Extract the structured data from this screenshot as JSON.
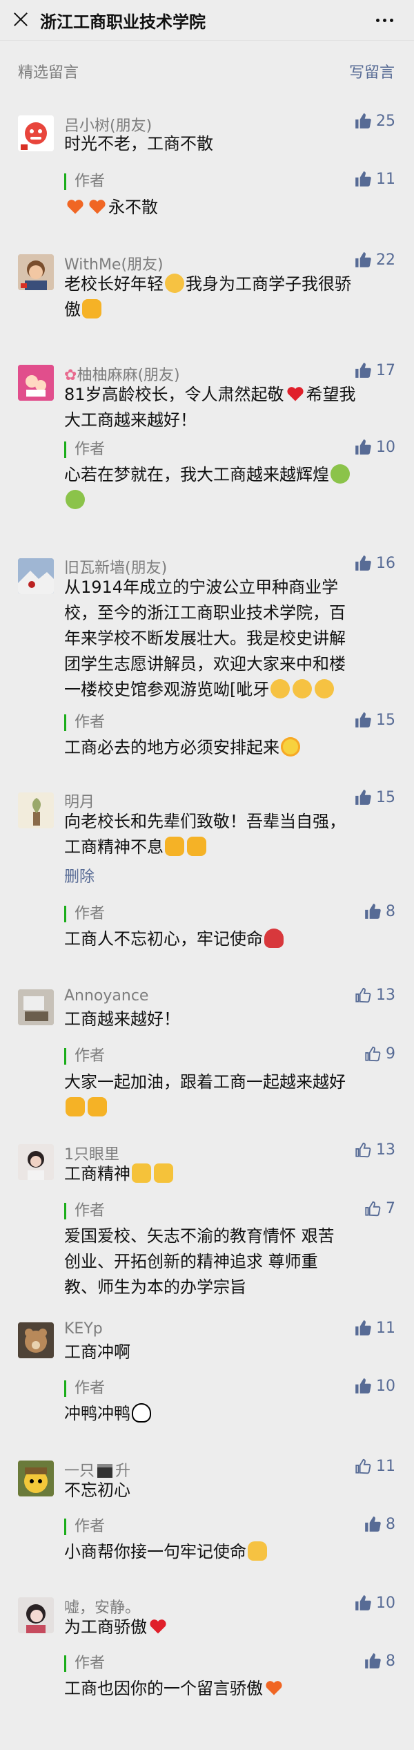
{
  "header": {
    "title": "浙江工商职业技术学院"
  },
  "section": {
    "label": "精选留言",
    "write_label": "写留言"
  },
  "reply_label": "作者",
  "colors": {
    "link": "#576b95",
    "reply_bar": "#1aad19",
    "name_gray": "#7d7d7d"
  },
  "comments": [
    {
      "name": "吕小树(朋友)",
      "likes": "25",
      "liked": true,
      "lines": [
        "时光不老，工商不散"
      ],
      "reply": {
        "likes": "11",
        "liked": true,
        "lines": [
          "永不散"
        ]
      }
    },
    {
      "name": "WithMe(朋友)",
      "likes": "22",
      "liked": true,
      "lines": [
        "老校长好年轻",
        "我身为工商学子我很骄",
        "傲"
      ]
    },
    {
      "name": "柚柚麻麻(朋友)",
      "likes": "17",
      "liked": true,
      "lines": [
        "81岁高龄校长，令人肃然起敬",
        "希望我",
        "大工商越来越好！"
      ],
      "reply": {
        "likes": "10",
        "liked": true,
        "lines": [
          "心若在梦就在，我大工商越来越辉煌"
        ]
      }
    },
    {
      "name": "旧瓦新墙(朋友)",
      "likes": "16",
      "liked": true,
      "lines": [
        "从1914年成立的宁波公立甲种商业学",
        "校，至今的浙江工商职业技术学院，百",
        "年来学校不断发展壮大。我是校史讲解",
        "团学生志愿讲解员，欢迎大家来中和楼",
        "一楼校史馆参观游览呦[呲牙"
      ],
      "reply": {
        "likes": "15",
        "liked": true,
        "lines": [
          "工商必去的地方必须安排起来"
        ]
      }
    },
    {
      "name": "明月",
      "likes": "15",
      "liked": true,
      "lines": [
        "向老校长和先辈们致敬！吾辈当自强，",
        "工商精神不息"
      ],
      "delete": "删除",
      "reply": {
        "likes": "8",
        "liked": true,
        "lines": [
          "工商人不忘初心，牢记使命"
        ]
      }
    },
    {
      "name": "Annoyance",
      "likes": "13",
      "liked": false,
      "lines": [
        "工商越来越好！"
      ],
      "reply": {
        "likes": "9",
        "liked": false,
        "lines": [
          "大家一起加油，跟着工商一起越来越好"
        ]
      }
    },
    {
      "name": "1只眼里",
      "likes": "13",
      "liked": false,
      "lines": [
        "工商精神"
      ],
      "reply": {
        "likes": "7",
        "liked": false,
        "lines": [
          "爱国爱校、矢志不渝的教育情怀  艰苦",
          "创业、开拓创新的精神追求   尊师重",
          "教、师生为本的办学宗旨"
        ]
      }
    },
    {
      "name": "KEYp",
      "likes": "11",
      "liked": true,
      "lines": [
        "工商冲啊"
      ],
      "reply": {
        "likes": "10",
        "liked": true,
        "lines": [
          "冲鸭冲鸭"
        ]
      }
    },
    {
      "name": "一只",
      "name_suffix": "升",
      "likes": "11",
      "liked": false,
      "lines": [
        "不忘初心"
      ],
      "reply": {
        "likes": "8",
        "liked": true,
        "lines": [
          "小商帮你接一句牢记使命"
        ]
      }
    },
    {
      "name": "嘘，安静。",
      "likes": "10",
      "liked": true,
      "lines": [
        "为工商骄傲"
      ],
      "reply": {
        "likes": "8",
        "liked": true,
        "lines": [
          "工商也因你的一个留言骄傲"
        ]
      }
    }
  ]
}
